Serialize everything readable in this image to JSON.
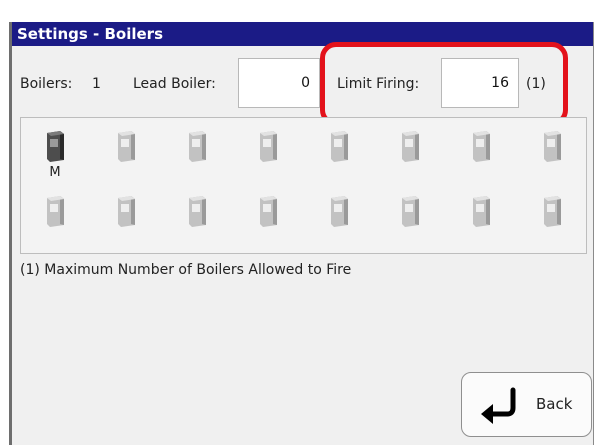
{
  "window": {
    "title": "Settings - Boilers"
  },
  "header": {
    "boilers_label": "Boilers:",
    "boilers_count": "1",
    "lead_boiler_label": "Lead Boiler:",
    "lead_boiler_value": "0",
    "limit_firing_label": "Limit Firing:",
    "limit_firing_value": "16",
    "limit_firing_note": "(1)"
  },
  "grid": {
    "rows": [
      [
        {
          "state": "master",
          "label": "M"
        },
        {
          "state": "idle",
          "label": ""
        },
        {
          "state": "idle",
          "label": ""
        },
        {
          "state": "idle",
          "label": ""
        },
        {
          "state": "idle",
          "label": ""
        },
        {
          "state": "idle",
          "label": ""
        },
        {
          "state": "idle",
          "label": ""
        },
        {
          "state": "idle",
          "label": ""
        }
      ],
      [
        {
          "state": "idle",
          "label": ""
        },
        {
          "state": "idle",
          "label": ""
        },
        {
          "state": "idle",
          "label": ""
        },
        {
          "state": "idle",
          "label": ""
        },
        {
          "state": "idle",
          "label": ""
        },
        {
          "state": "idle",
          "label": ""
        },
        {
          "state": "idle",
          "label": ""
        },
        {
          "state": "idle",
          "label": ""
        }
      ]
    ]
  },
  "footnote": "(1) Maximum Number of Boilers Allowed to Fire",
  "actions": {
    "back_label": "Back"
  },
  "colors": {
    "title_bar": "#1b1b86",
    "highlight": "#e3121b",
    "master_boiler": "#4a4a4a",
    "idle_boiler": "#bdbdbd"
  },
  "icons": {
    "boiler": "boiler-icon",
    "back": "back-arrow-icon"
  }
}
